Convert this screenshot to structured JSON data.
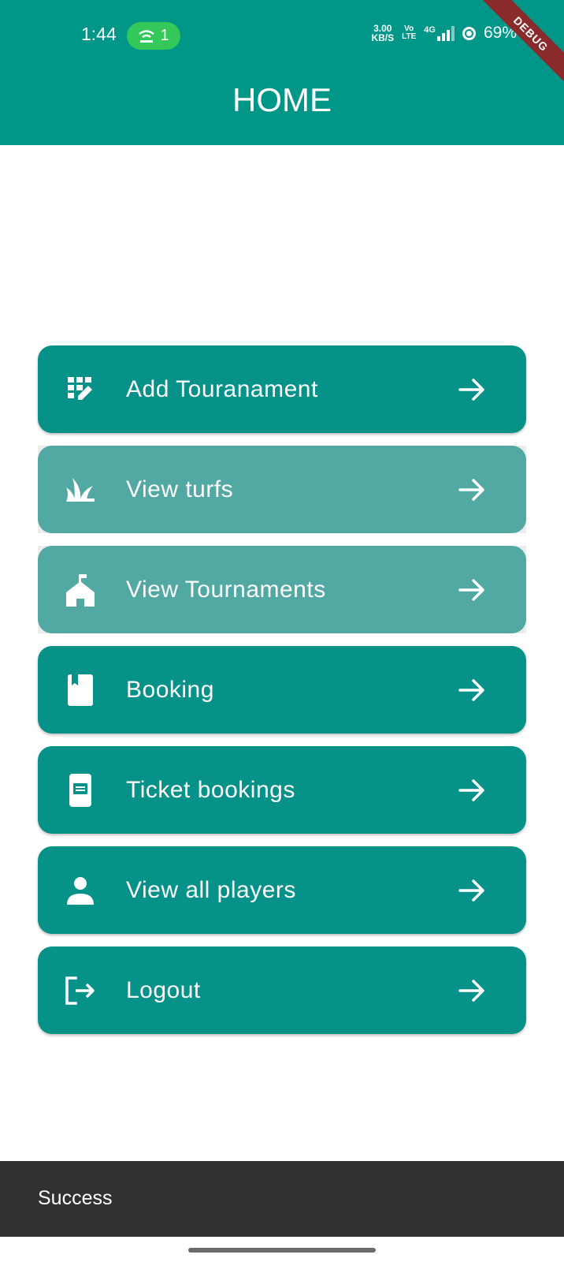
{
  "status_bar": {
    "time": "1:44",
    "hotspot_count": "1",
    "net_speed": "3.00",
    "net_speed_unit": "KB/S",
    "volte_top": "Vo",
    "volte_bottom": "LTE",
    "network": "4G",
    "battery": "69%"
  },
  "debug_banner": "DEBUG",
  "header": {
    "title": "HOME"
  },
  "menu": {
    "items": [
      {
        "label": "Add Touranament",
        "icon": "edit-grid-icon",
        "state": "normal"
      },
      {
        "label": "View turfs",
        "icon": "grass-icon",
        "state": "pressed"
      },
      {
        "label": "View Tournaments",
        "icon": "school-icon",
        "state": "pressed"
      },
      {
        "label": "Booking",
        "icon": "book-icon",
        "state": "normal"
      },
      {
        "label": "Ticket bookings",
        "icon": "receipt-icon",
        "state": "normal"
      },
      {
        "label": "View all players",
        "icon": "person-icon",
        "state": "normal"
      },
      {
        "label": "Logout",
        "icon": "logout-icon",
        "state": "normal"
      }
    ]
  },
  "snackbar": {
    "message": "Success"
  },
  "colors": {
    "primary": "#009688",
    "button": "#069189",
    "button_pressed": "#52a8a2",
    "snackbar": "#323033",
    "hotspot": "#34c759"
  }
}
